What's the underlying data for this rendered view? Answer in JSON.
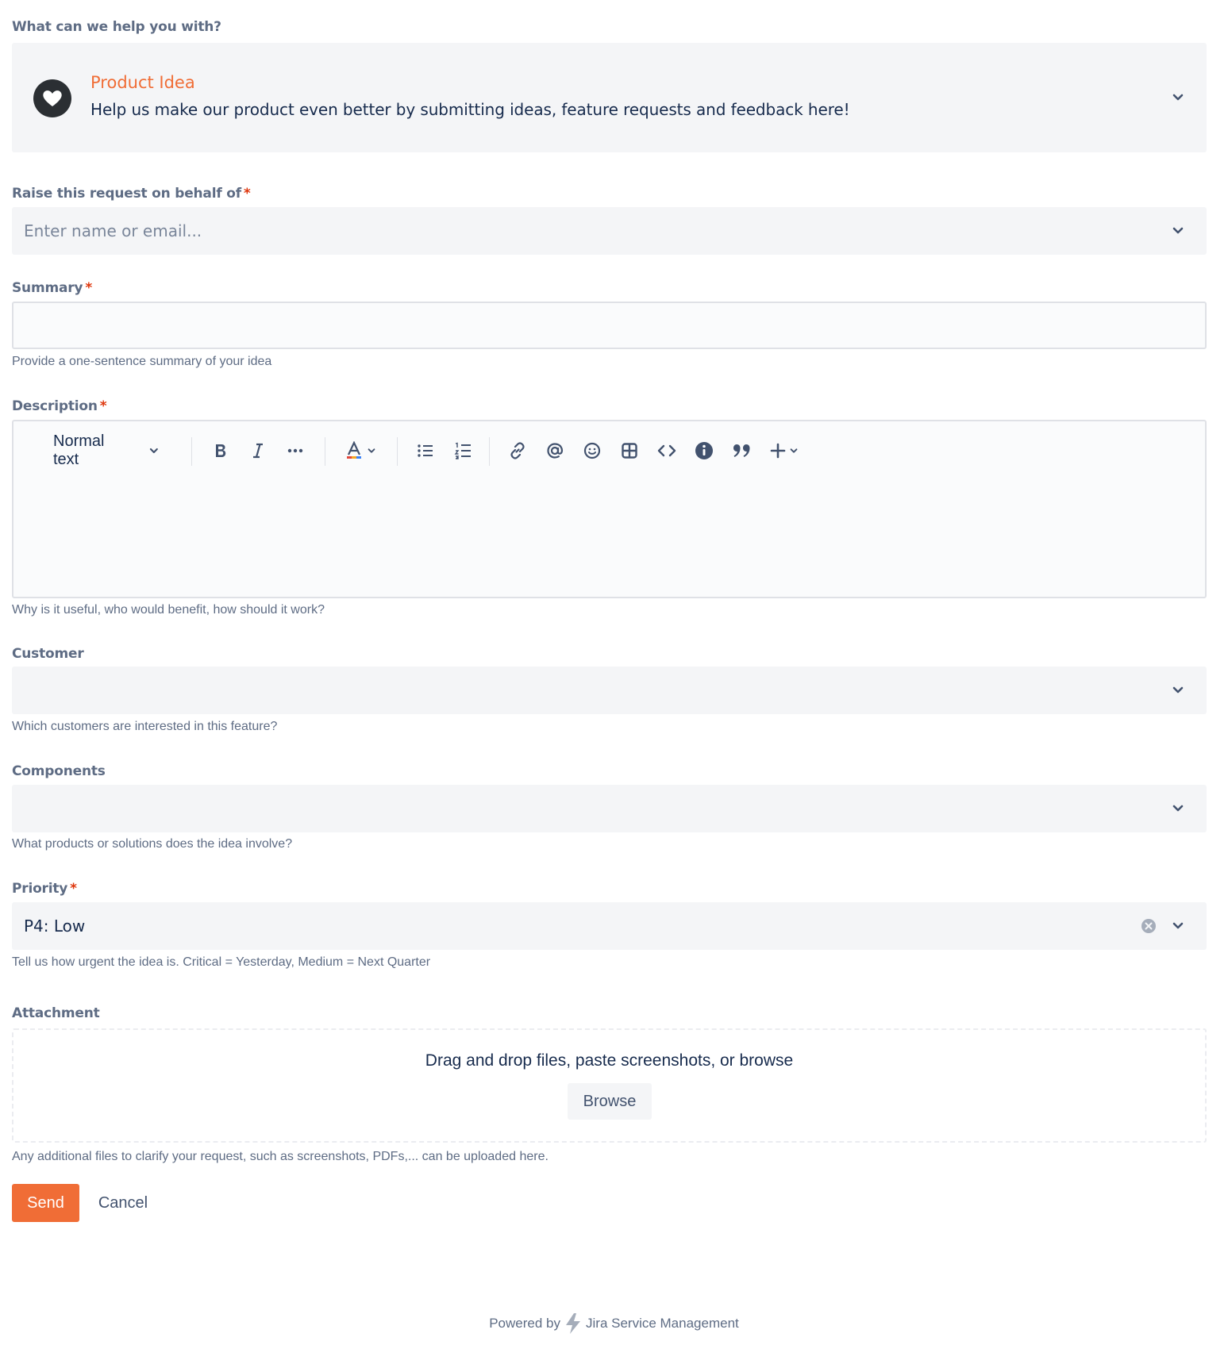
{
  "request_type": {
    "section_label": "What can we help you with?",
    "name": "Product Idea",
    "description": "Help us make our product even better by submitting ideas, feature requests and feedback here!",
    "icon": "heart-icon"
  },
  "on_behalf": {
    "label": "Raise this request on behalf of",
    "required_mark": "*",
    "placeholder": "Enter name or email..."
  },
  "summary": {
    "label": "Summary",
    "required_mark": "*",
    "value": "",
    "help": "Provide a one-sentence summary of your idea"
  },
  "description": {
    "label": "Description",
    "required_mark": "*",
    "help": "Why is it useful, who would benefit, how should it work?",
    "toolbar": {
      "text_style": "Normal text",
      "items": [
        "bold-icon",
        "italic-icon",
        "more-formatting-icon",
        "text-color-icon",
        "bullet-list-icon",
        "numbered-list-icon",
        "link-icon",
        "mention-icon",
        "emoji-icon",
        "table-icon",
        "code-icon",
        "info-panel-icon",
        "quote-icon",
        "insert-plus-icon"
      ]
    }
  },
  "customer": {
    "label": "Customer",
    "help": "Which customers are interested in this feature?"
  },
  "components": {
    "label": "Components",
    "help": "What products or solutions does the idea involve?"
  },
  "priority": {
    "label": "Priority",
    "required_mark": "*",
    "value": "P4: Low",
    "help": "Tell us how urgent the idea is. Critical = Yesterday, Medium = Next Quarter"
  },
  "attachment": {
    "label": "Attachment",
    "dropzone_text": "Drag and drop files, paste screenshots, or browse",
    "browse_label": "Browse",
    "help": "Any additional files to clarify your request, such as screenshots, PDFs,... can be uploaded here."
  },
  "actions": {
    "send_label": "Send",
    "cancel_label": "Cancel"
  },
  "footer": {
    "powered_by": "Powered by",
    "product": "Jira Service Management"
  },
  "colors": {
    "accent": "#f06d36",
    "required": "#de350b",
    "field_bg": "#f4f5f7",
    "label": "#5e6c84"
  }
}
